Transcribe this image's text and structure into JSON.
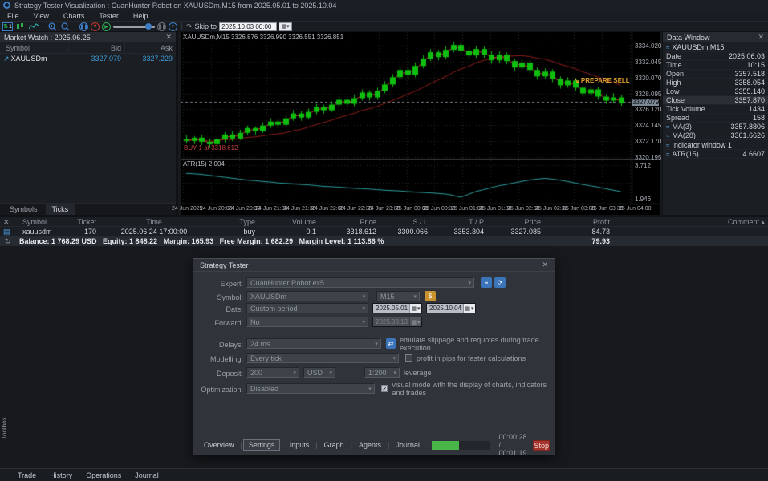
{
  "window": {
    "title": "Strategy Tester Visualization : CuanHunter Robot on XAUUSDm,M15 from 2025.05.01 to 2025.10.04",
    "menu": [
      "File",
      "View",
      "Charts",
      "Tester",
      "Help"
    ]
  },
  "toolbar": {
    "skip_to_label": "Skip to",
    "skip_to_value": "2025.10.03 00:00"
  },
  "market_watch": {
    "title": "Market Watch : 2025.06.25",
    "close": "✕",
    "columns": [
      "Symbol",
      "Bid",
      "Ask"
    ],
    "rows": [
      {
        "symbol": "XAUUSDm",
        "bid": "3327.079",
        "ask": "3327.229"
      }
    ],
    "tabs": [
      "Symbols",
      "Ticks"
    ],
    "active_tab": "Ticks"
  },
  "chart": {
    "header": "XAUUSDm,M15 3326.876 3326.990 3326.551 3326.851",
    "annotation_sell": "↘ PREPARE SELL",
    "annotation_buy": "BUY 1 at 3318.612",
    "atr_title": "ATR(15) 2.004",
    "current_price": "3327.079"
  },
  "chart_data": {
    "type": "candlestick",
    "symbol": "XAUUSDm",
    "timeframe": "M15",
    "title": "XAUUSDm,M15",
    "price_axis_labels": [
      "3334.020",
      "3332.045",
      "3330.070",
      "3328.095",
      "3326.120",
      "3324.145",
      "3322.170",
      "3320.195"
    ],
    "price_range": [
      3320.2,
      3335.3
    ],
    "current_price": 3327.079,
    "time_labels": [
      "24 Jun 2025",
      "24 Jun 20:00",
      "24 Jun 20:30",
      "24 Jun 21:00",
      "24 Jun 21:30",
      "24 Jun 22:00",
      "24 Jun 22:30",
      "24 Jun 23:00",
      "25 Jun 00:00",
      "25 Jun 00:30",
      "25 Jun 01:00",
      "25 Jun 01:30",
      "25 Jun 02:00",
      "25 Jun 02:30",
      "25 Jun 03:00",
      "25 Jun 03:30",
      "25 Jun 04:00"
    ],
    "candles": [
      [
        3322.4,
        3322.9,
        3321.9,
        3322.2
      ],
      [
        3322.2,
        3322.8,
        3321.8,
        3322.6
      ],
      [
        3322.6,
        3322.9,
        3321.7,
        3322.1
      ],
      [
        3322.1,
        3322.5,
        3321.4,
        3321.8
      ],
      [
        3321.8,
        3322.7,
        3321.5,
        3322.4
      ],
      [
        3322.4,
        3323.3,
        3322.0,
        3323.0
      ],
      [
        3323.0,
        3323.4,
        3322.2,
        3322.5
      ],
      [
        3322.5,
        3323.6,
        3322.3,
        3323.2
      ],
      [
        3323.2,
        3324.1,
        3322.9,
        3323.8
      ],
      [
        3323.8,
        3324.0,
        3323.0,
        3323.4
      ],
      [
        3323.4,
        3324.5,
        3323.2,
        3324.1
      ],
      [
        3324.1,
        3325.0,
        3323.8,
        3324.6
      ],
      [
        3324.6,
        3324.9,
        3323.8,
        3324.2
      ],
      [
        3324.2,
        3325.4,
        3324.0,
        3325.0
      ],
      [
        3325.0,
        3326.0,
        3324.7,
        3325.6
      ],
      [
        3325.6,
        3325.9,
        3324.7,
        3325.1
      ],
      [
        3325.1,
        3326.2,
        3324.9,
        3325.8
      ],
      [
        3325.8,
        3326.8,
        3325.5,
        3326.4
      ],
      [
        3326.4,
        3326.7,
        3325.6,
        3326.0
      ],
      [
        3326.0,
        3327.1,
        3325.8,
        3326.7
      ],
      [
        3326.7,
        3327.7,
        3326.4,
        3327.3
      ],
      [
        3327.3,
        3327.6,
        3326.4,
        3326.8
      ],
      [
        3326.8,
        3327.9,
        3326.5,
        3327.5
      ],
      [
        3327.5,
        3328.6,
        3327.2,
        3328.2
      ],
      [
        3328.2,
        3328.5,
        3327.2,
        3327.6
      ],
      [
        3327.6,
        3328.8,
        3327.3,
        3328.4
      ],
      [
        3328.4,
        3329.6,
        3328.1,
        3329.2
      ],
      [
        3329.2,
        3330.5,
        3328.9,
        3330.1
      ],
      [
        3330.1,
        3331.4,
        3329.8,
        3331.0
      ],
      [
        3331.0,
        3331.3,
        3330.0,
        3330.4
      ],
      [
        3330.4,
        3331.9,
        3330.1,
        3331.5
      ],
      [
        3331.5,
        3332.8,
        3331.2,
        3332.4
      ],
      [
        3332.4,
        3333.6,
        3332.1,
        3333.2
      ],
      [
        3333.2,
        3333.5,
        3332.2,
        3332.6
      ],
      [
        3332.6,
        3333.9,
        3332.3,
        3333.5
      ],
      [
        3333.5,
        3334.5,
        3333.2,
        3334.1
      ],
      [
        3334.1,
        3334.4,
        3333.0,
        3333.4
      ],
      [
        3333.4,
        3333.8,
        3332.4,
        3332.8
      ],
      [
        3332.8,
        3334.0,
        3332.5,
        3333.6
      ],
      [
        3333.6,
        3333.9,
        3332.5,
        3332.9
      ],
      [
        3332.9,
        3333.3,
        3331.8,
        3332.2
      ],
      [
        3332.2,
        3333.3,
        3331.9,
        3332.9
      ],
      [
        3332.9,
        3333.2,
        3331.7,
        3332.1
      ],
      [
        3332.1,
        3332.4,
        3330.9,
        3331.3
      ],
      [
        3331.3,
        3332.3,
        3331.0,
        3331.9
      ],
      [
        3331.9,
        3332.2,
        3330.6,
        3331.0
      ],
      [
        3331.0,
        3331.3,
        3329.8,
        3330.2
      ],
      [
        3330.2,
        3331.2,
        3329.9,
        3330.8
      ],
      [
        3330.8,
        3331.1,
        3329.5,
        3329.9
      ],
      [
        3329.9,
        3330.2,
        3328.7,
        3329.1
      ],
      [
        3329.1,
        3330.1,
        3328.8,
        3329.7
      ],
      [
        3329.7,
        3330.0,
        3328.4,
        3328.8
      ],
      [
        3328.8,
        3329.1,
        3327.7,
        3328.1
      ],
      [
        3328.1,
        3329.0,
        3327.8,
        3328.6
      ],
      [
        3328.6,
        3328.9,
        3327.3,
        3327.7
      ],
      [
        3327.7,
        3328.0,
        3326.8,
        3327.2
      ],
      [
        3327.2,
        3328.1,
        3326.9,
        3327.6
      ],
      [
        3327.6,
        3327.9,
        3326.551,
        3326.851
      ]
    ],
    "ma_fast_period": 3,
    "ma_slow_period": 28,
    "atr": {
      "label": "ATR(15) 2.004",
      "axis_labels": [
        "3.712",
        "1.946"
      ],
      "range": [
        1.8,
        3.9
      ],
      "values": [
        3.3,
        3.28,
        3.25,
        3.2,
        3.15,
        3.1,
        3.05,
        3.0,
        2.95,
        2.92,
        2.88,
        2.85,
        2.8,
        2.78,
        2.75,
        2.72,
        2.7,
        2.66,
        2.62,
        2.6,
        2.58,
        2.55,
        2.52,
        2.5,
        2.48,
        2.45,
        2.42,
        2.4,
        2.38,
        2.35,
        2.32,
        2.3,
        2.28,
        2.25,
        2.22,
        2.15,
        2.05,
        2.2,
        2.35,
        2.45,
        2.55,
        2.65,
        2.72,
        2.8,
        2.88,
        2.95,
        3.0,
        3.04,
        3.0,
        2.95,
        2.88,
        2.8,
        2.72,
        2.65,
        2.58,
        2.5,
        2.42,
        2.35
      ]
    }
  },
  "data_window": {
    "title": "Data Window",
    "close": "✕",
    "symbol_header": "XAUUSDm,M15",
    "rows": [
      {
        "label": "Date",
        "value": "2025.06.03"
      },
      {
        "label": "Time",
        "value": "10:15"
      },
      {
        "label": "Open",
        "value": "3357.518"
      },
      {
        "label": "High",
        "value": "3358.054"
      },
      {
        "label": "Low",
        "value": "3355.140"
      },
      {
        "label": "Close",
        "value": "3357.870",
        "highlight": true
      },
      {
        "label": "Tick Volume",
        "value": "1434"
      },
      {
        "label": "Spread",
        "value": "158"
      },
      {
        "label": "MA(3)",
        "value": "3357.8806",
        "icon": true
      },
      {
        "label": "MA(28)",
        "value": "3361.6626",
        "icon": true
      }
    ],
    "indicator_header": "Indicator window 1",
    "indicator_rows": [
      {
        "label": "ATR(15)",
        "value": "4.6607",
        "icon": true
      }
    ]
  },
  "trade_panel": {
    "close": "✕",
    "columns": [
      "Symbol",
      "Ticket",
      "Time",
      "Type",
      "Volume",
      "Price",
      "S / L",
      "T / P",
      "Price",
      "Profit",
      "Comment ▴"
    ],
    "rows": [
      {
        "symbol": "xauusdm",
        "ticket": "170",
        "time": "2025.06.24 17:00:00",
        "type": "buy",
        "volume": "0.1",
        "price": "3318.612",
        "sl": "3300.066",
        "tp": "3353.304",
        "price2": "3327.085",
        "profit": "84.73",
        "comment": ""
      }
    ],
    "balance_text": "Balance: 1 768.29 USD   Equity: 1 848.22   Margin: 165.93   Free Margin: 1 682.29   Margin Level: 1 113.86 %",
    "balance_profit": "79.93"
  },
  "tester_dialog": {
    "title": "Strategy Tester",
    "close": "✕",
    "expert_label": "Expert:",
    "expert_value": "CuanHunter Robot.ex5",
    "symbol_label": "Symbol:",
    "symbol_value": "XAUUSDm",
    "period_value": "M15",
    "date_label": "Date:",
    "date_mode": "Custom period",
    "date_from": "2025.05.01",
    "date_to": "2025.10.04",
    "forward_label": "Forward:",
    "forward_value": "No",
    "forward_date": "2025.08.13",
    "delays_label": "Delays:",
    "delays_value": "24 ms",
    "delays_note": "emulate slippage and requotes during trade execution",
    "modelling_label": "Modelling:",
    "modelling_value": "Every tick",
    "modelling_note": "profit in pips for faster calculations",
    "deposit_label": "Deposit:",
    "deposit_value": "200",
    "deposit_currency": "USD",
    "leverage_value": "1:200",
    "leverage_note": "leverage",
    "optimization_label": "Optimization:",
    "optimization_value": "Disabled",
    "optimization_note": "visual mode with the display of charts, indicators and trades",
    "tabs": [
      "Overview",
      "Settings",
      "Inputs",
      "Graph",
      "Agents",
      "Journal"
    ],
    "active_tab": "Settings",
    "progress_percent": 47,
    "time_text": "00:00:28 / 00:01:19",
    "stop_label": "Stop"
  },
  "status_bar": {
    "tabs": [
      "Trade",
      "History",
      "Operations",
      "Journal"
    ],
    "toolbox_label": "Toolbox"
  },
  "colors": {
    "candle_green": "#0fbf0f",
    "ma_fast_red": "#c9392c",
    "ma_slow_red": "#8f1f1a",
    "atr_teal": "#2fa0a0",
    "bid_blue": "#3f9bd8",
    "grid": "#262626",
    "axis_text": "#a8adb5",
    "accent_orange": "#e0a030",
    "progress_green": "#49b649",
    "stop_red": "#a8342e"
  }
}
